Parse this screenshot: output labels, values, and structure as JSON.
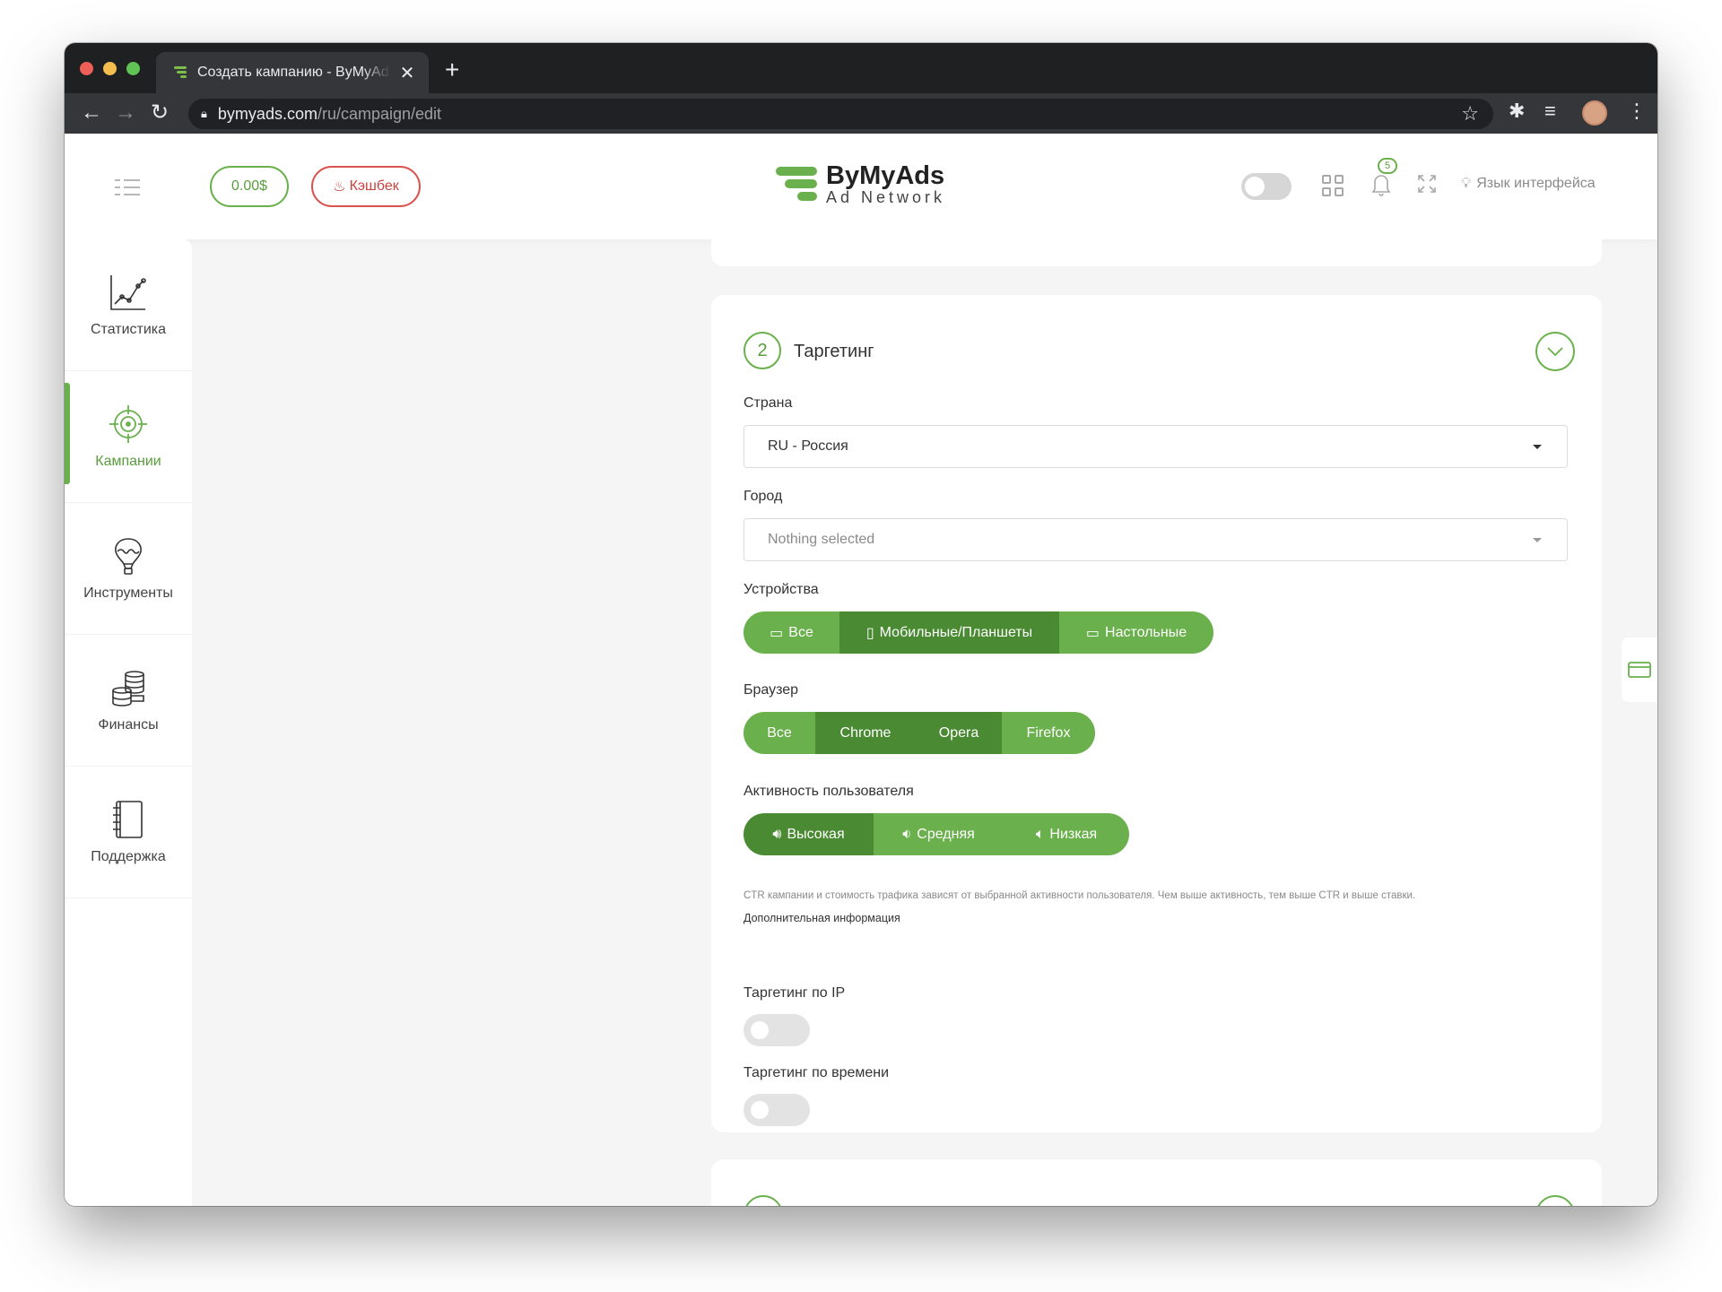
{
  "browser": {
    "tab_title": "Создать кампанию - ByMyAds",
    "tab_close": "✕",
    "new_tab": "+",
    "url_host": "bymyads.com",
    "url_path": "/ru/campaign/edit"
  },
  "header": {
    "balance": "0.00$",
    "cashback": "Кэшбек",
    "logo_title": "ByMyAds",
    "logo_subtitle": "Ad Network",
    "notifications_count": "5",
    "language": "Язык интерфейса"
  },
  "sidebar": {
    "items": [
      {
        "label": "Статистика",
        "icon": "chart-icon"
      },
      {
        "label": "Кампании",
        "icon": "target-icon",
        "active": true
      },
      {
        "label": "Инструменты",
        "icon": "balloon-icon"
      },
      {
        "label": "Финансы",
        "icon": "coins-icon"
      },
      {
        "label": "Поддержка",
        "icon": "notebook-icon"
      }
    ]
  },
  "targeting": {
    "step_number": "2",
    "title": "Таргетинг",
    "country_label": "Страна",
    "country_value": "RU - Россия",
    "city_label": "Город",
    "city_placeholder": "Nothing selected",
    "devices_label": "Устройства",
    "devices": [
      "Все",
      "Мобильные/Планшеты",
      "Настольные"
    ],
    "browser_label": "Браузер",
    "browsers": [
      "Все",
      "Chrome",
      "Opera",
      "Firefox"
    ],
    "activity_label": "Активность пользователя",
    "activity": [
      "Высокая",
      "Средняя",
      "Низкая"
    ],
    "hint": "CTR кампании и стоимость трафика зависят от выбранной активности пользователя. Чем выше активность, тем выше CTR и выше ставки.",
    "more_info": "Дополнительная информация",
    "ip_label": "Таргетинг по IP",
    "ip_enabled": false,
    "time_label": "Таргетинг по времени",
    "time_enabled": false
  },
  "colors": {
    "accent": "#6ab04c",
    "accent_dark": "#4a8a33",
    "danger": "#d9534f"
  }
}
